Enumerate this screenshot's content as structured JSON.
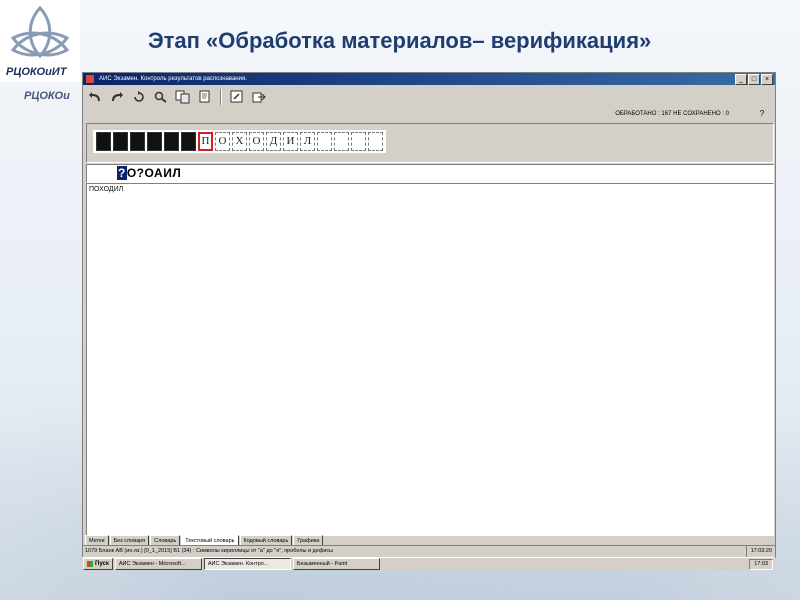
{
  "slide": {
    "title": "Этап «Обработка материалов– верификация»",
    "logo_text": "РЦОКОиИТ",
    "logo_text_secondary": "РЦОКОи"
  },
  "window": {
    "title": "АИС Экзамен. Контроль результатов распознавания.",
    "min_label": "_",
    "max_label": "□",
    "close_label": "×"
  },
  "toolbar": {
    "icons": [
      "undo-icon",
      "redo-icon",
      "refresh-icon",
      "search-icon",
      "copy-icon",
      "page-icon",
      "edit-icon",
      "export-icon"
    ]
  },
  "status": {
    "counts": "ОБРАБОТАНО : 167   НЕ СОХРАНЕНО : 0",
    "help": "?"
  },
  "image_cells": [
    "",
    "",
    "",
    "",
    "",
    "",
    "П",
    "О",
    "Х",
    "О",
    "Д",
    "И",
    "Л",
    "",
    "",
    "",
    ""
  ],
  "active_cell_index": 6,
  "recognized": {
    "unknown": "?",
    "rest": "О?ОАИЛ"
  },
  "editor": {
    "text": "ПОХОДИЛ"
  },
  "tabs": [
    "Метки",
    "Без словаря",
    "Словарь",
    "Текстовый словарь",
    "Кодовый словарь",
    "Графика"
  ],
  "active_tab": 3,
  "statusbar": {
    "left": "1079 Бланк АВ (ин.яз.) [0_1_2015]   В1 (34) : Символы кириллицы от \"а\" до \"я\", пробелы и дефисы",
    "time": "17:03:20"
  },
  "taskbar": {
    "start": "Пуск",
    "tasks": [
      "АИС Экзамен - Microsoft...",
      "АИС Экзамен. Контро...",
      "Безымянный - Paint"
    ],
    "active_task": 1,
    "clock": "17:03"
  },
  "colors": {
    "title": "#1f3d6e",
    "titlebar": "#0a246a",
    "active_cell_border": "#d32020",
    "window_bg": "#d4d0c8"
  }
}
